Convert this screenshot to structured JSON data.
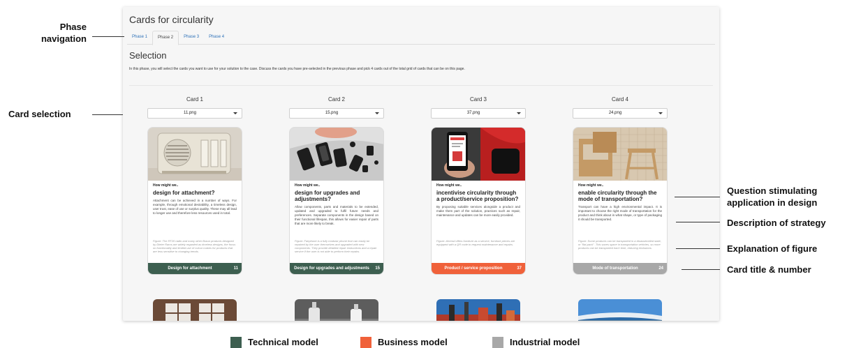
{
  "app": {
    "title": "Cards for circularity",
    "tabs": [
      {
        "label": "Phase 1"
      },
      {
        "label": "Phase 2"
      },
      {
        "label": "Phase 3"
      },
      {
        "label": "Phase 4"
      }
    ],
    "active_tab": "Phase 2",
    "section_title": "Selection",
    "intro": "In this phase, you will select the cards you want to use for your solution to the case. Discuss the cards you have pre-selected in the previous phase and pick 4 cards out of the total grid of cards that can be on this page."
  },
  "cards": [
    {
      "column_title": "Card 1",
      "selected_file": "11.png",
      "how_might_we": "How might we..",
      "question": "design for attachment?",
      "description": "Attachment can be achieved in a number of ways. For example, through emotional desirability, a timeless design, user trust, ease of use or surplus quality. These may all lead to longer use and therefore less resources used in total.",
      "figure_caption": "Figure: The RT20 radio and many other Braun products designed by Dieter Rams are widely regarded as timeless designs, the focus on functionality and limited use of colour makes for products that are less sensitive to changing trends.",
      "footer_title": "Design for attachment",
      "number": "11",
      "model": "technical"
    },
    {
      "column_title": "Card 2",
      "selected_file": "15.png",
      "how_might_we": "How might we..",
      "question": "design for upgrades and adjustments?",
      "description": "Allow components, parts and materials to be extended, updated and upgraded to fulfil future needs and preferences. Separate components in the design based on their functional lifespan, this allows for easier repair of parts that are more likely to break.",
      "figure_caption": "Figure: Fairphone is a fully modular phone that can easily be repaired by the user themselves and upgraded with new components. They provide detailed repair instructions and a repair service if the user is not able to perform their repairs.",
      "footer_title": "Design for upgrades and adjustments",
      "number": "15",
      "model": "technical"
    },
    {
      "column_title": "Card 3",
      "selected_file": "37.png",
      "how_might_we": "How might we..",
      "question": "incentivise circularity through a product/service proposition?",
      "description": "By proposing suitable services alongside a product and make them part of the solution, practices such as repair, maintenance and updates can be more easily provided.",
      "figure_caption": "Figure: Ahrend offers furniture as a service, furniture pieces are equipped with a QR code to request maintenance and repairs.",
      "footer_title": "Product / service proposition",
      "number": "37",
      "model": "business"
    },
    {
      "column_title": "Card 4",
      "selected_file": "24.png",
      "how_might_we": "How might we..",
      "question": "enable circularity through the mode of transportation?",
      "description": "Transport can have a high environmental impact. It is important to choose the right mode of transportation for the product and think about in what shape, or type of packaging it should be transported.",
      "figure_caption": "Figure: Some products can be transported in a disassembled state, or \"flat-pack\". This saves space in transportation vehicles, so more products can be transported each time, reducing emissions.",
      "footer_title": "Mode of transportation",
      "number": "24",
      "model": "industrial"
    }
  ],
  "annotations": {
    "phase_navigation": [
      "Phase",
      "navigation"
    ],
    "card_selection": "Card selection",
    "question": [
      "Question stimulating",
      "application in design"
    ],
    "description": "Description of strategy",
    "figure": "Explanation of figure",
    "title_number": "Card title & number"
  },
  "legend": [
    {
      "label": "Technical model",
      "color": "#3d5f50"
    },
    {
      "label": "Business model",
      "color": "#f0613a"
    },
    {
      "label": "Industrial model",
      "color": "#a8a8a8"
    }
  ],
  "colors": {
    "technical": "#3d5f50",
    "business": "#f0613a",
    "industrial": "#a8a8a8"
  }
}
